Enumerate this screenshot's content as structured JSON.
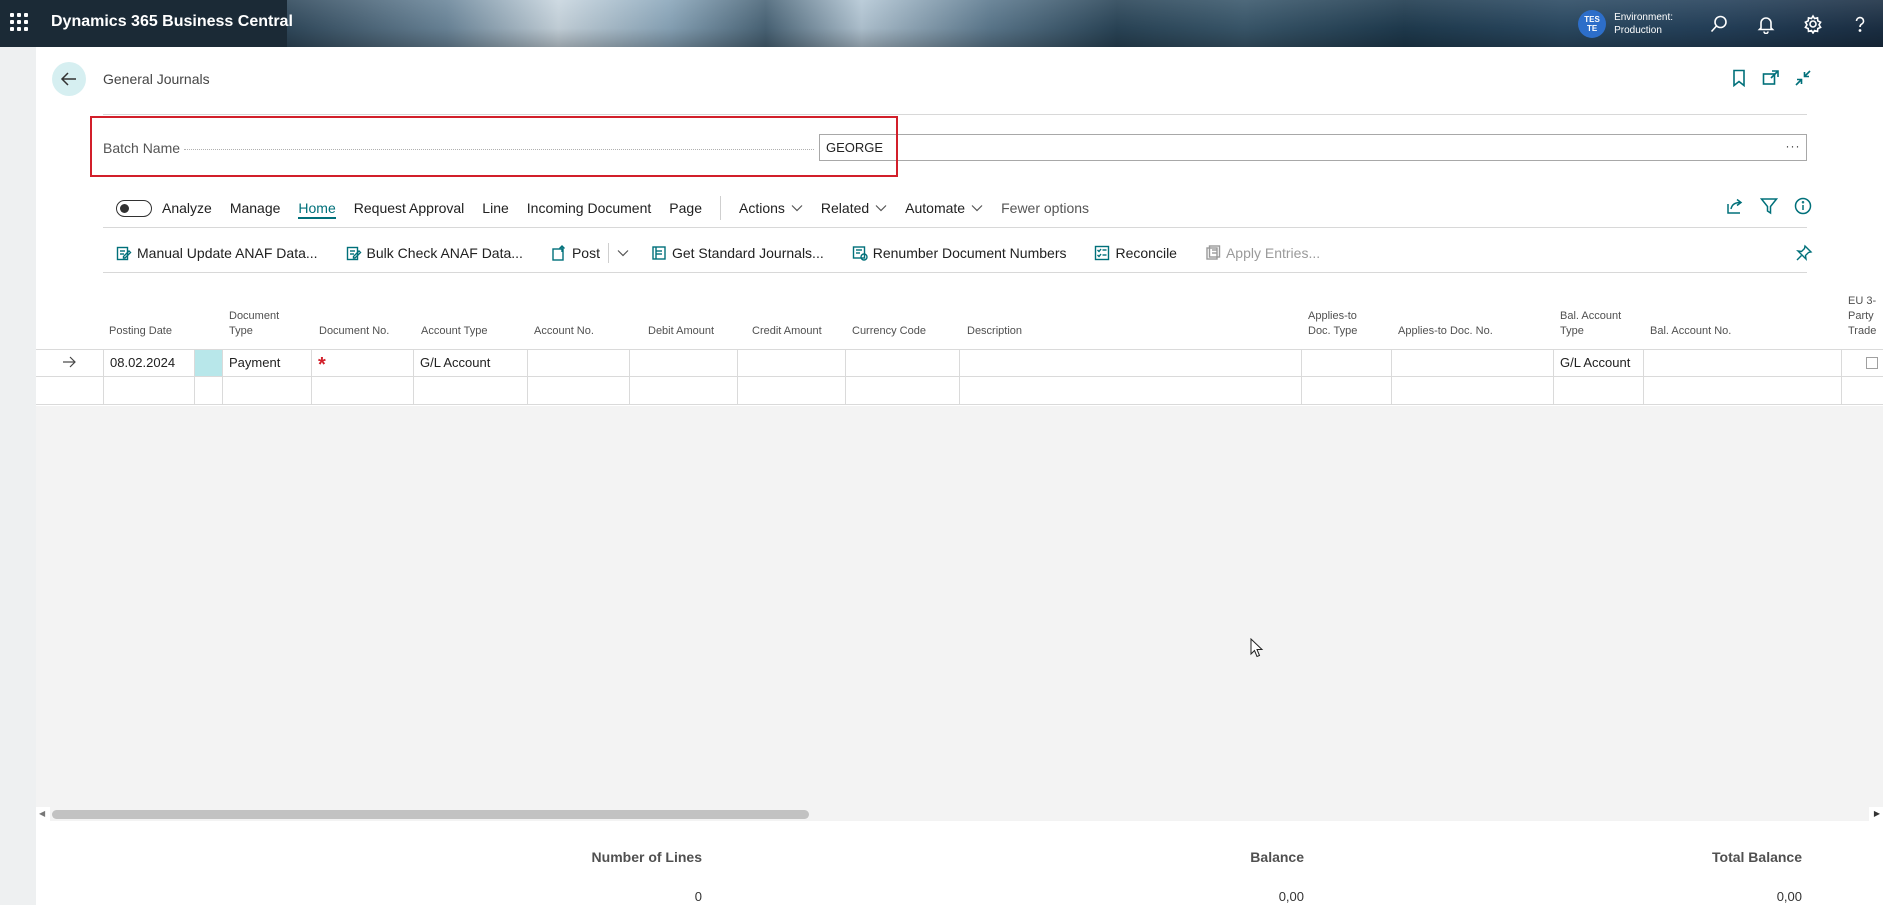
{
  "app": {
    "title": "Dynamics 365 Business Central",
    "user_initials_line1": "TES",
    "user_initials_line2": "TE",
    "environment_label": "Environment:",
    "environment_value": "Production"
  },
  "page": {
    "title": "General Journals"
  },
  "batch": {
    "label": "Batch Name",
    "value": "GEORGE",
    "more": "···"
  },
  "actionbar": {
    "analyze": "Analyze",
    "manage": "Manage",
    "home": "Home",
    "request_approval": "Request Approval",
    "line": "Line",
    "incoming_document": "Incoming Document",
    "page": "Page",
    "actions": "Actions",
    "related": "Related",
    "automate": "Automate",
    "fewer_options": "Fewer options"
  },
  "commands": {
    "manual_update": "Manual Update ANAF Data...",
    "bulk_check": "Bulk Check ANAF Data...",
    "post": "Post",
    "get_standard": "Get Standard Journals...",
    "renumber": "Renumber Document Numbers",
    "reconcile": "Reconcile",
    "apply_entries": "Apply Entries..."
  },
  "grid": {
    "columns": {
      "posting_date": "Posting Date",
      "document_type": "Document Type",
      "document_no": "Document No.",
      "account_type": "Account Type",
      "account_no": "Account No.",
      "debit_amount": "Debit Amount",
      "credit_amount": "Credit Amount",
      "currency_code": "Currency Code",
      "description": "Description",
      "applies_to_doc_type": "Applies-to Doc. Type",
      "applies_to_doc_no": "Applies-to Doc. No.",
      "bal_account_type": "Bal. Account Type",
      "bal_account_no": "Bal. Account No.",
      "eu_3_party": "EU 3-Party Trade"
    },
    "row1": {
      "posting_date": "08.02.2024",
      "document_type": "Payment",
      "document_no_required": "*",
      "account_type": "G/L Account",
      "bal_account_type": "G/L Account"
    }
  },
  "footer": {
    "number_of_lines_label": "Number of Lines",
    "number_of_lines_value": "0",
    "balance_label": "Balance",
    "balance_value": "0,00",
    "total_balance_label": "Total Balance",
    "total_balance_value": "0,00"
  },
  "icons": {
    "waffle": "app-launcher-icon",
    "search": "search-icon",
    "bell": "bell-icon",
    "gear": "gear-icon",
    "help": "help-icon"
  },
  "colors": {
    "accent": "#00707a",
    "highlight": "#d21f2a",
    "appbar": "#1b2a36"
  }
}
